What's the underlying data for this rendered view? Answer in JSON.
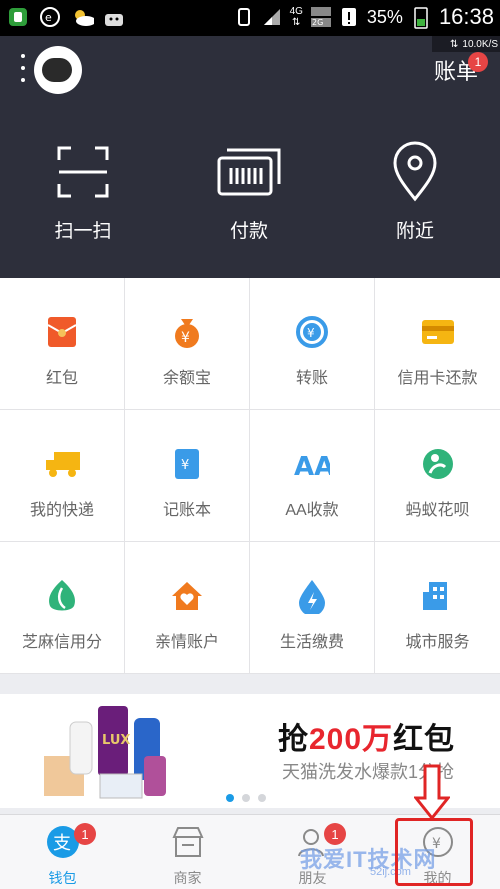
{
  "status_bar": {
    "battery": "35%",
    "time": "16:38",
    "net_4g": "4G",
    "net_2g": "2G"
  },
  "header": {
    "net_speed": "10.0K/S",
    "bill_label": "账单",
    "bill_badge": "1",
    "actions": [
      {
        "label": "扫一扫",
        "icon": "scan-icon"
      },
      {
        "label": "付款",
        "icon": "barcode-icon"
      },
      {
        "label": "附近",
        "icon": "location-pin-icon"
      }
    ]
  },
  "grid": [
    {
      "label": "红包",
      "icon": "red-envelope-icon",
      "color": "#f05a2a"
    },
    {
      "label": "余额宝",
      "icon": "money-bag-icon",
      "color": "#f07a1e"
    },
    {
      "label": "转账",
      "icon": "transfer-icon",
      "color": "#3a9be8"
    },
    {
      "label": "信用卡还款",
      "icon": "credit-card-icon",
      "color": "#f5b512"
    },
    {
      "label": "我的快递",
      "icon": "truck-icon",
      "color": "#f5b512"
    },
    {
      "label": "记账本",
      "icon": "notebook-icon",
      "color": "#3a9be8"
    },
    {
      "label": "AA收款",
      "icon": "aa-icon",
      "color": "#3a9be8"
    },
    {
      "label": "蚂蚁花呗",
      "icon": "huabei-icon",
      "color": "#2fb37a"
    },
    {
      "label": "芝麻信用分",
      "icon": "sesame-icon",
      "color": "#2fb37a"
    },
    {
      "label": "亲情账户",
      "icon": "family-house-icon",
      "color": "#f07a1e"
    },
    {
      "label": "生活缴费",
      "icon": "drop-icon",
      "color": "#3a9be8"
    },
    {
      "label": "城市服务",
      "icon": "building-icon",
      "color": "#3a9be8"
    }
  ],
  "banner": {
    "title_pre": "抢",
    "title_red": "200万",
    "title_post": "红包",
    "subtitle": "天猫洗发水爆款1分抢",
    "product_text": "LUX"
  },
  "tabs": [
    {
      "label": "钱包",
      "icon": "alipay-icon",
      "badge": "1",
      "active": true
    },
    {
      "label": "商家",
      "icon": "store-icon",
      "badge": "",
      "active": false
    },
    {
      "label": "朋友",
      "icon": "friends-icon",
      "badge": "1",
      "active": false
    },
    {
      "label": "我的",
      "icon": "yen-circle-icon",
      "badge": "",
      "active": false
    }
  ],
  "watermark": {
    "main": "我爱IT技术网",
    "small": "52ij.com"
  }
}
